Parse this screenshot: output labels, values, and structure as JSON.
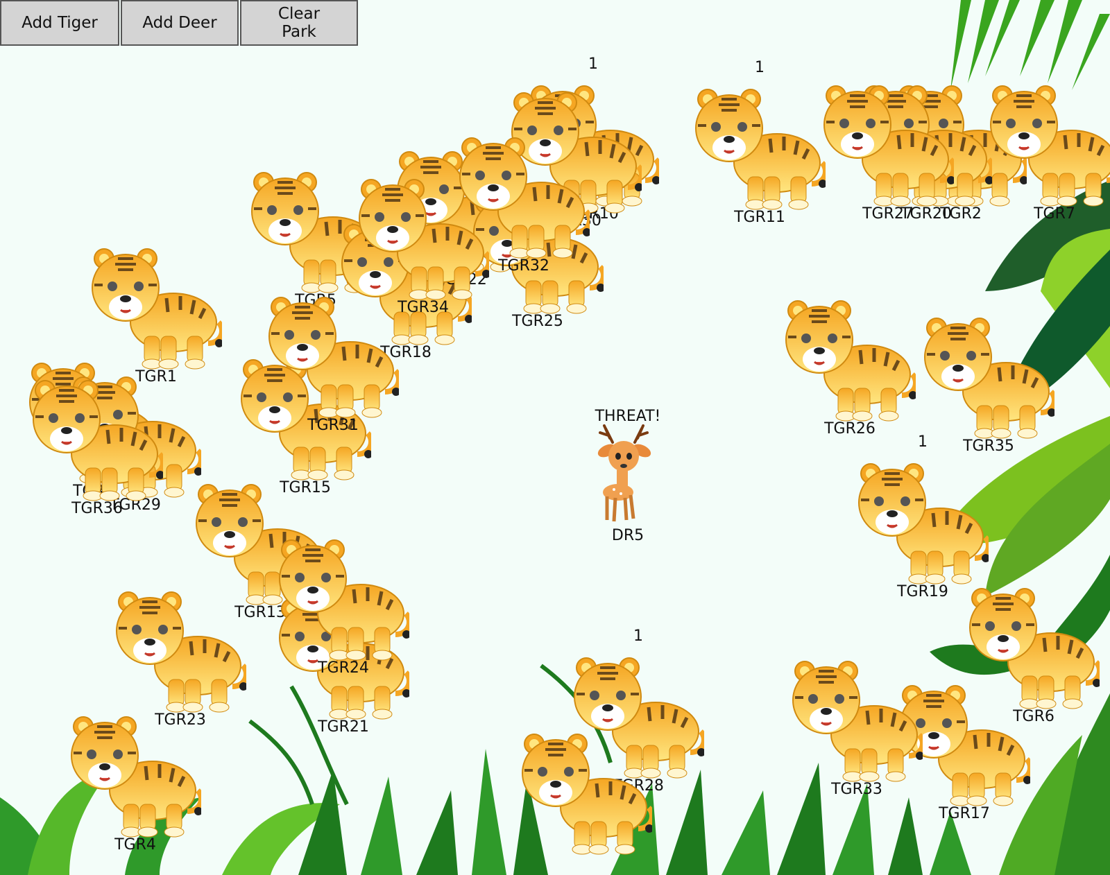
{
  "toolbar": {
    "add_tiger": "Add Tiger",
    "add_deer": "Add Deer",
    "clear_park": "Clear Park"
  },
  "colors": {
    "background": "#f3fdf9",
    "tiger_body": "#f7b731",
    "tiger_light": "#ffe58a",
    "stripe": "#6b4a1a",
    "leaf_dark": "#1e7a1e",
    "leaf_light": "#8ed12a"
  },
  "tigers": [
    {
      "label": "TGR1"
    },
    {
      "label": "TGR2"
    },
    {
      "label": "TGR3"
    },
    {
      "label": "TGR4"
    },
    {
      "label": "TGR5"
    },
    {
      "label": "TGR6"
    },
    {
      "label": "TGR7"
    },
    {
      "label": "TGR10"
    },
    {
      "label": "TGR11"
    },
    {
      "label": "TGR13"
    },
    {
      "label": "TGR15"
    },
    {
      "label": "TGR17"
    },
    {
      "label": "TGR18"
    },
    {
      "label": "TGR19"
    },
    {
      "label": "TGR20"
    },
    {
      "label": "TGR21"
    },
    {
      "label": "TGR22"
    },
    {
      "label": "TGR23"
    },
    {
      "label": "TGR24"
    },
    {
      "label": "TGR25"
    },
    {
      "label": "TGR26"
    },
    {
      "label": "TGR27"
    },
    {
      "label": "TGR28"
    },
    {
      "label": "TGR29"
    },
    {
      "label": "TGR30"
    },
    {
      "label": "TGR31"
    },
    {
      "label": "TGR32"
    },
    {
      "label": "TGR33"
    },
    {
      "label": "TGR34"
    },
    {
      "label": "TGR35"
    },
    {
      "label": "TGR36"
    }
  ],
  "counts": [
    "1",
    "1",
    "1",
    "1"
  ],
  "deer": {
    "label": "DR5",
    "status": "THREAT!"
  }
}
